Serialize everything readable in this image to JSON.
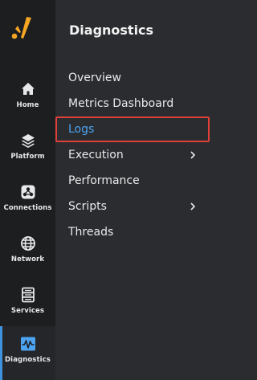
{
  "rail": {
    "items": [
      {
        "label": "Home",
        "icon": "home-icon"
      },
      {
        "label": "Platform",
        "icon": "layers-icon"
      },
      {
        "label": "Connections",
        "icon": "connections-icon"
      },
      {
        "label": "Network",
        "icon": "globe-icon"
      },
      {
        "label": "Services",
        "icon": "server-icon"
      },
      {
        "label": "Diagnostics",
        "icon": "pulse-icon",
        "active": true
      }
    ]
  },
  "panel": {
    "title": "Diagnostics",
    "menu": [
      {
        "label": "Overview"
      },
      {
        "label": "Metrics Dashboard"
      },
      {
        "label": "Logs",
        "selected": true
      },
      {
        "label": "Execution",
        "has_submenu": true
      },
      {
        "label": "Performance"
      },
      {
        "label": "Scripts",
        "has_submenu": true
      },
      {
        "label": "Threads"
      }
    ]
  },
  "colors": {
    "accent": "#3d93df",
    "selected_text": "#4da3f0",
    "highlight_border": "#e0403a",
    "logo": "#f5a623"
  }
}
